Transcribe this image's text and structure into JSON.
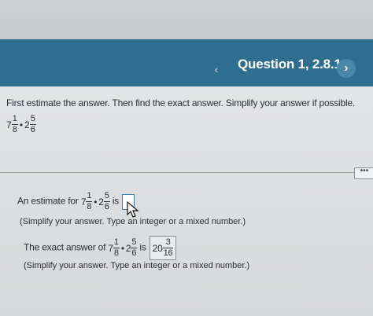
{
  "header": {
    "title": "Question 1, 2.8.1",
    "prev_symbol": "‹",
    "next_symbol": "›"
  },
  "instruction": "First estimate the answer. Then find the exact answer. Simplify your answer if possible.",
  "problem": {
    "first_whole": "7",
    "first_num": "1",
    "first_den": "8",
    "operator": "•",
    "second_whole": "2",
    "second_num": "5",
    "second_den": "6"
  },
  "more_button": "•••",
  "estimate": {
    "prefix": "An estimate for",
    "suffix": "is",
    "answer_value": "",
    "hint": "(Simplify your answer. Type an integer or a mixed number.)"
  },
  "exact": {
    "prefix": "The exact answer of",
    "suffix": "is",
    "answer_whole": "20",
    "answer_num": "3",
    "answer_den": "16",
    "hint": "(Simplify your answer. Type an integer or a mixed number.)"
  }
}
